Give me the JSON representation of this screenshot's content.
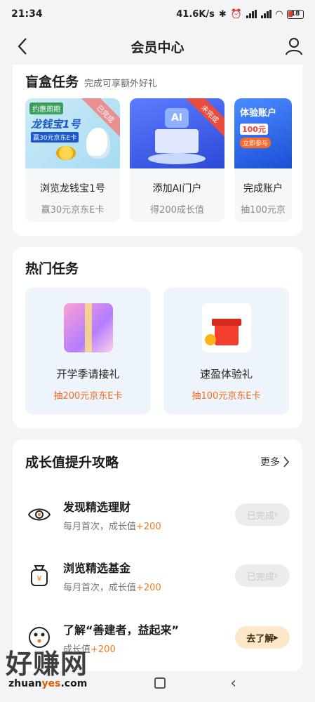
{
  "status": {
    "time": "21:34",
    "speed": "41.6K/s",
    "battery": "18"
  },
  "nav": {
    "title": "会员中心"
  },
  "blind_box": {
    "title": "盲盒任务",
    "subtitle": "完成可享额外好礼",
    "items": [
      {
        "name": "浏览龙钱宝1号",
        "reward": "赢30元京东E卡",
        "status": "已完成",
        "banner_title": "龙钱宝1号",
        "banner_sub": "赢30元京东E卡",
        "banner_tag": "约惠周期"
      },
      {
        "name": "添加AI门户",
        "reward": "得200成长值",
        "status": "未完成",
        "banner_title": "AI"
      },
      {
        "name": "完成账户",
        "reward": "抽100元京",
        "banner_title": "体验账户",
        "banner_sub": "100元",
        "banner_btn": "立即参与"
      }
    ]
  },
  "hot": {
    "title": "热门任务",
    "items": [
      {
        "name": "开学季请接礼",
        "reward": "抽200元京东E卡"
      },
      {
        "name": "速盈体验礼",
        "reward": "抽100元京东E卡"
      }
    ]
  },
  "growth": {
    "title": "成长值提升攻略",
    "more": "更多",
    "items": [
      {
        "title": "发现精选理财",
        "desc": "每月首次，成长值",
        "points": "+200",
        "button": "已完成",
        "icon": "eye-icon"
      },
      {
        "title": "浏览精选基金",
        "desc": "每月首次，成长值",
        "points": "+200",
        "button": "已完成",
        "icon": "fund-bag-icon"
      },
      {
        "title": "了解“善建者，益起来”",
        "desc": "成长值",
        "points": "+200",
        "button": "去了解",
        "icon": "charity-icon"
      }
    ]
  },
  "watermark": {
    "text": "好赚网",
    "url_a": "zhuan",
    "url_b": "yes",
    "url_c": ".com"
  },
  "colors": {
    "accent_orange": "#f26b1d",
    "card_blue": "#eef4fc",
    "done_gray": "#ececec"
  }
}
